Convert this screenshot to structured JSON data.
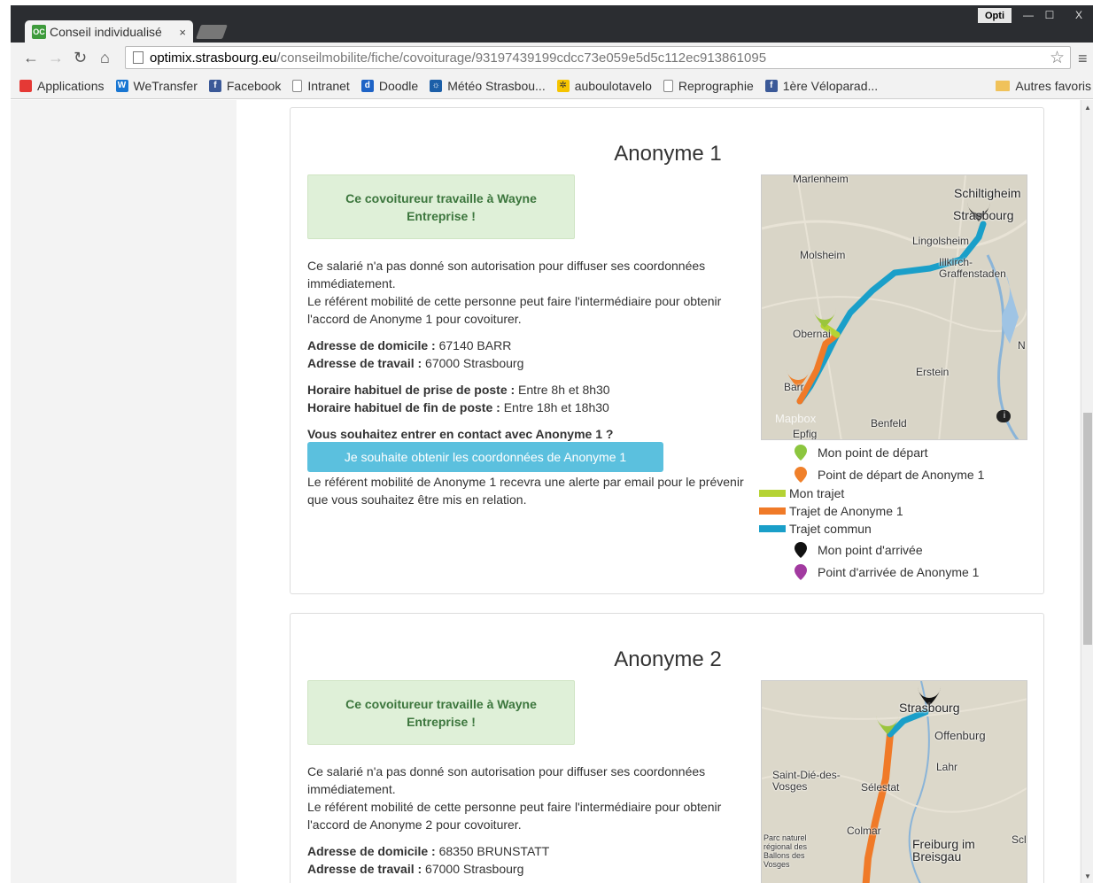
{
  "browser": {
    "tab_title": "Conseil individualisé",
    "tab_close": "×",
    "favicon_text": "OC",
    "profile_button": "Opti",
    "window_minimize": "—",
    "window_maximize": "☐",
    "window_close": "X",
    "url_host": "optimix.strasbourg.eu",
    "url_path": "/conseilmobilite/fiche/covoiturage/93197439199cdcc73e059e5d5c112ec913861095"
  },
  "bookmarks": {
    "items": [
      {
        "label": "Applications",
        "color": "#e53935",
        "icon": "apps-grid-icon"
      },
      {
        "label": "WeTransfer",
        "color": "#1976d2",
        "icon": "wetransfer-icon"
      },
      {
        "label": "Facebook",
        "color": "#3b5998",
        "icon": "facebook-icon"
      },
      {
        "label": "Intranet",
        "color": "#ffffff",
        "icon": "page-icon"
      },
      {
        "label": "Doodle",
        "color": "#1e63c6",
        "icon": "doodle-icon"
      },
      {
        "label": "Météo Strasbou...",
        "color": "#1c5fa8",
        "icon": "weather-icon"
      },
      {
        "label": "auboulotavelo",
        "color": "#f5c400",
        "icon": "bike-icon"
      },
      {
        "label": "Reprographie",
        "color": "#ffffff",
        "icon": "page-icon"
      },
      {
        "label": "1ère Véloparad...",
        "color": "#3b5998",
        "icon": "facebook-icon"
      }
    ],
    "other": "Autres favoris"
  },
  "cards": [
    {
      "title": "Anonyme 1",
      "notice": "Ce covoitureur travaille à Wayne Entreprise !",
      "privacy_1": "Ce salarié n'a pas donné son autorisation pour diffuser ses coordonnées immédiatement.",
      "privacy_2": "Le référent mobilité de cette personne peut faire l'intermédiaire pour obtenir l'accord de Anonyme 1 pour covoiturer.",
      "home_label": "Adresse de domicile :",
      "home_value": " 67140 BARR",
      "work_label": "Adresse de travail :",
      "work_value": " 67000 Strasbourg",
      "start_label": "Horaire habituel de prise de poste :",
      "start_value": " Entre 8h et 8h30",
      "end_label": "Horaire habituel de fin de poste :",
      "end_value": " Entre 18h et 18h30",
      "contact_question": "Vous souhaitez entrer en contact avec Anonyme 1 ?",
      "contact_button": "Je souhaite obtenir les coordonnées de Anonyme 1",
      "contact_note": "Le référent mobilité de Anonyme 1 recevra une alerte par email pour le prévenir que vous souhaitez être mis en relation.",
      "map_labels": [
        "Marlenheim",
        "Schiltigheim",
        "Strasbourg",
        "Lingolsheim",
        "Molsheim",
        "Illkirch-Graffenstaden",
        "Obernai",
        "Erstein",
        "Barr",
        "Benfeld",
        "Epfig",
        "N"
      ],
      "mapbox": "Mapbox",
      "legend": [
        {
          "label": "Mon point de départ",
          "kind": "pin",
          "color": "#8cc63f"
        },
        {
          "label": "Point de départ de Anonyme 1",
          "kind": "pin",
          "color": "#f0802a"
        },
        {
          "label": "Mon trajet",
          "kind": "swatch",
          "color": "#b5d334"
        },
        {
          "label": "Trajet de Anonyme 1",
          "kind": "swatch",
          "color": "#f07a28"
        },
        {
          "label": "Trajet commun",
          "kind": "swatch",
          "color": "#1a9fc9"
        },
        {
          "label": "Mon point d'arrivée",
          "kind": "pin",
          "color": "#111111"
        },
        {
          "label": "Point d'arrivée de Anonyme 1",
          "kind": "pin",
          "color": "#a23aa0"
        }
      ]
    },
    {
      "title": "Anonyme 2",
      "notice": "Ce covoitureur travaille à Wayne Entreprise !",
      "privacy_1": "Ce salarié n'a pas donné son autorisation pour diffuser ses coordonnées immédiatement.",
      "privacy_2": "Le référent mobilité de cette personne peut faire l'intermédiaire pour obtenir l'accord de Anonyme 2 pour covoiturer.",
      "home_label": "Adresse de domicile :",
      "home_value": " 68350 BRUNSTATT",
      "work_label": "Adresse de travail :",
      "work_value": " 67000 Strasbourg",
      "map_labels": [
        "Strasbourg",
        "Offenburg",
        "Saint-Dié-des-Vosges",
        "Lahr",
        "Sélestat",
        "Colmar",
        "Freiburg im Breisgau",
        "Parc naturel régional des Ballons des Vosges",
        "Scl"
      ]
    }
  ]
}
